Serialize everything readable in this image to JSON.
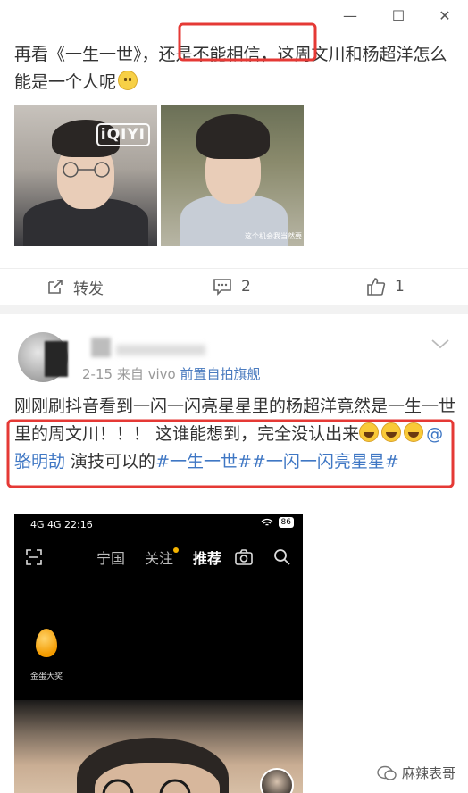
{
  "window": {
    "minimize_glyph": "—",
    "maximize_glyph": "☐",
    "close_glyph": "✕"
  },
  "post1": {
    "text_part1": "再看《一生一世》，",
    "text_highlight": "还是不能相信，",
    "text_part2": "这周文川和杨超洋怎么能是一个人呢",
    "emoji": "smile-emoji",
    "image1_watermark": "iQIYI",
    "image2_subtitle": "这个机会我当然要",
    "actions": {
      "repost_label": "转发",
      "comment_count": "2",
      "like_count": "1"
    }
  },
  "post2": {
    "meta_time": "2-15",
    "meta_source": "来自 vivo",
    "meta_device": "前置自拍旗舰",
    "text_part1": "刚刚刷抖音看到一闪一闪亮星星里的杨超洋竟然是",
    "text_highlight_1": "一生一世里的周文川！！！",
    "text_highlight_2": "这谁能想到，完全没认",
    "text_highlight_3": "出来",
    "mention": "@骆明劼",
    "text_part2": " 演技可以的",
    "tag1": "#一生一世#",
    "tag2_line1": "#一",
    "tag2_line2": "闪一闪亮星星#",
    "screenshot": {
      "time": "22:16",
      "signal": "4G 4G",
      "battery": "86",
      "tabs": [
        "宁国",
        "关注",
        "推荐"
      ],
      "active_tab": "推荐",
      "egg_label": "金蛋大奖"
    }
  },
  "watermark": "麻辣表哥",
  "colors": {
    "highlight_box": "#e53935",
    "link_blue": "#3f77c4",
    "egg_orange": "#f39b00"
  }
}
